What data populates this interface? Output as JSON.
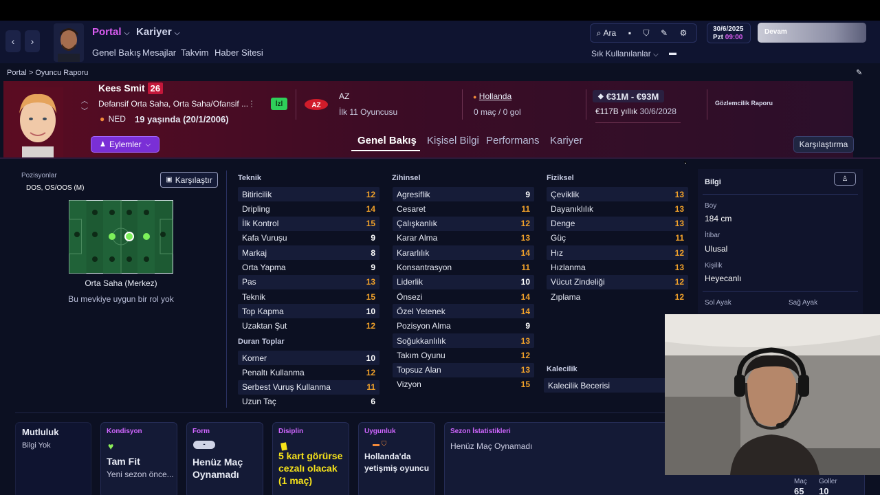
{
  "header": {
    "nav_back": "‹",
    "nav_forward": "›",
    "portal": "Portal",
    "kariyer": "Kariyer",
    "submenu": [
      "Genel Bakış",
      "Mesajlar",
      "Takvim",
      "Haber Sitesi"
    ],
    "search_label": "Ara",
    "favorites": "Sık Kullanılanlar",
    "date_line1": "30/6/2025",
    "date_day": "Pzt",
    "date_time": "09:00",
    "continue_label": "Devam"
  },
  "breadcrumb": {
    "root": "Portal",
    "sep": ">",
    "current": "Oyuncu Raporu"
  },
  "player": {
    "name": "Kees Smit",
    "number": "26",
    "positions": "Defansif Orta Saha, Orta Saha/Ofansif ...",
    "nation_code": "NED",
    "age_line": "19 yaşında (20/1/2006)",
    "status_badge": "İzl",
    "club": "AZ",
    "squad": "İlk 11 Oyuncusu",
    "country": "Hollanda",
    "caps": "0 maç / 0 gol",
    "value": "€31M - €93M",
    "wage": "€117B yıllık",
    "contract_end": "30/6/2028",
    "scout_report": "Gözlemcilik Raporu",
    "actions_label": "Eylemler"
  },
  "tabs": [
    "Genel Bakış",
    "Kişisel Bilgi",
    "Performans",
    "Kariyer"
  ],
  "compare_top": "Karşılaştırma",
  "positions_panel": {
    "title": "Pozisyonlar",
    "codes": "DOS, OS/OOS (M)",
    "compare": "Karşılaştır",
    "role_name": "Orta Saha (Merkez)",
    "role_note": "Bu mevkiye uygun bir rol yok"
  },
  "attributes": {
    "teknik_title": "Teknik",
    "teknik": [
      {
        "name": "Bitiricilik",
        "value": "12",
        "color": "orange"
      },
      {
        "name": "Dripling",
        "value": "14",
        "color": "orange"
      },
      {
        "name": "İlk Kontrol",
        "value": "15",
        "color": "orange"
      },
      {
        "name": "Kafa Vuruşu",
        "value": "9",
        "color": "white"
      },
      {
        "name": "Markaj",
        "value": "8",
        "color": "white"
      },
      {
        "name": "Orta Yapma",
        "value": "9",
        "color": "white"
      },
      {
        "name": "Pas",
        "value": "13",
        "color": "orange"
      },
      {
        "name": "Teknik",
        "value": "15",
        "color": "orange"
      },
      {
        "name": "Top Kapma",
        "value": "10",
        "color": "white"
      },
      {
        "name": "Uzaktan Şut",
        "value": "12",
        "color": "orange"
      }
    ],
    "duran_title": "Duran Toplar",
    "duran": [
      {
        "name": "Korner",
        "value": "10",
        "color": "white"
      },
      {
        "name": "Penaltı Kullanma",
        "value": "12",
        "color": "orange"
      },
      {
        "name": "Serbest Vuruş Kullanma",
        "value": "11",
        "color": "orange"
      },
      {
        "name": "Uzun Taç",
        "value": "6",
        "color": "white"
      }
    ],
    "zihinsel_title": "Zihinsel",
    "zihinsel": [
      {
        "name": "Agresiflik",
        "value": "9",
        "color": "white"
      },
      {
        "name": "Cesaret",
        "value": "11",
        "color": "orange"
      },
      {
        "name": "Çalışkanlık",
        "value": "12",
        "color": "orange"
      },
      {
        "name": "Karar Alma",
        "value": "13",
        "color": "orange"
      },
      {
        "name": "Kararlılık",
        "value": "14",
        "color": "orange"
      },
      {
        "name": "Konsantrasyon",
        "value": "11",
        "color": "orange"
      },
      {
        "name": "Liderlik",
        "value": "10",
        "color": "white"
      },
      {
        "name": "Önsezi",
        "value": "14",
        "color": "orange"
      },
      {
        "name": "Özel Yetenek",
        "value": "14",
        "color": "orange"
      },
      {
        "name": "Pozisyon Alma",
        "value": "9",
        "color": "white"
      },
      {
        "name": "Soğukkanlılık",
        "value": "13",
        "color": "orange"
      },
      {
        "name": "Takım Oyunu",
        "value": "12",
        "color": "orange"
      },
      {
        "name": "Topsuz Alan",
        "value": "13",
        "color": "orange"
      },
      {
        "name": "Vizyon",
        "value": "15",
        "color": "orange"
      }
    ],
    "fiziksel_title": "Fiziksel",
    "fiziksel": [
      {
        "name": "Çeviklik",
        "value": "13",
        "color": "orange"
      },
      {
        "name": "Dayanıklılık",
        "value": "13",
        "color": "orange"
      },
      {
        "name": "Denge",
        "value": "13",
        "color": "orange"
      },
      {
        "name": "Güç",
        "value": "11",
        "color": "orange"
      },
      {
        "name": "Hız",
        "value": "12",
        "color": "orange"
      },
      {
        "name": "Hızlanma",
        "value": "13",
        "color": "orange"
      },
      {
        "name": "Vücut Zindeliği",
        "value": "12",
        "color": "orange"
      },
      {
        "name": "Zıplama",
        "value": "12",
        "color": "orange"
      }
    ],
    "kaleci_title": "Kalecilik",
    "kaleci_row": "Kalecilik Becerisi"
  },
  "info": {
    "title": "Bilgi",
    "boy_label": "Boy",
    "boy": "184 cm",
    "itibar_label": "İtibar",
    "itibar": "Ulusal",
    "kisilik_label": "Kişilik",
    "kisilik": "Heyecanlı",
    "sol_ayak": "Sol Ayak",
    "sag_ayak": "Sağ Ayak"
  },
  "cards": {
    "mutluluk_title": "Mutluluk",
    "mutluluk_value": "Bilgi Yok",
    "kondisyon_title": "Kondisyon",
    "kondisyon_value": "Tam Fit",
    "kondisyon_sub": "Yeni sezon önce...",
    "form_title": "Form",
    "form_badge": "-",
    "form_value": "Henüz Maç Oynamadı",
    "disiplin_title": "Disiplin",
    "disiplin_value": "5 kart görürse cezalı olacak (1 maç)",
    "uygunluk_title": "Uygunluk",
    "uygunluk_value": "Hollanda'da yetişmiş oyuncu",
    "sezon_title": "Sezon İstatistikleri",
    "sezon_value": "Henüz Maç Oynamadı",
    "mac_label": "Maç",
    "mac": "65",
    "goller_label": "Goller",
    "goller": "10"
  }
}
